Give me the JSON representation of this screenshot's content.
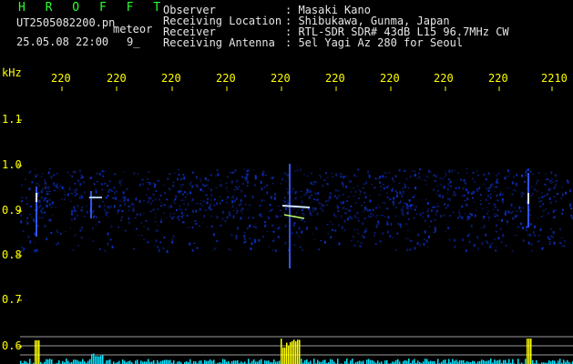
{
  "header": {
    "app_name": "H R O F F T",
    "filename": "UT2505082200.pn",
    "tag": "meteor",
    "datetime": "25.05.08 22:00",
    "counter": "9_",
    "info_labels": [
      "Observer",
      "Receiving Location",
      "Receiver",
      "Receiving Antenna"
    ],
    "info_values": [
      ": Masaki Kano",
      ": Shibukawa, Gunma, Japan",
      ": RTL-SDR SDR# 43dB L15 96.7MHz CW",
      ": 5el Yagi Az 280 for Seoul"
    ]
  },
  "y_axis": {
    "unit": "kHz",
    "ticks": [
      "1.1",
      "1.0",
      "0.9",
      "0.8",
      "0.7",
      "0.6"
    ]
  },
  "x_axis": {
    "ticks": [
      "220",
      "220",
      "220",
      "220",
      "220",
      "220",
      "220",
      "220",
      "220",
      "2210"
    ]
  },
  "colors": {
    "label_yellow": "#ffff00",
    "title_green": "#2cff2c",
    "text_white": "#e6e6e6",
    "signal_blue": "#1e3cff",
    "bar_cyan": "#00e5ff"
  }
}
